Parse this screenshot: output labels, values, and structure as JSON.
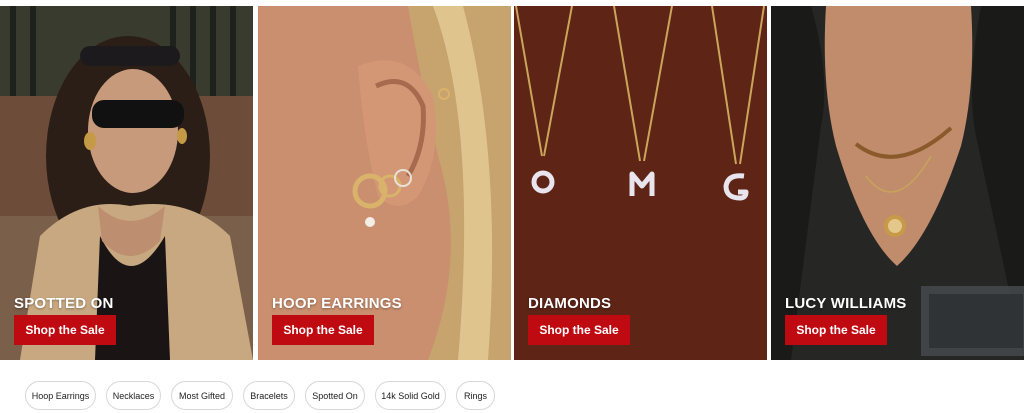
{
  "tiles": [
    {
      "title": "SPOTTED ON",
      "cta": "Shop the Sale"
    },
    {
      "title": "HOOP EARRINGS",
      "cta": "Shop the Sale"
    },
    {
      "title": "DIAMONDS",
      "cta": "Shop the Sale"
    },
    {
      "title": "LUCY WILLIAMS",
      "cta": "Shop the Sale"
    }
  ],
  "chips": [
    "Hoop Earrings",
    "Necklaces",
    "Most Gifted",
    "Bracelets",
    "Spotted On",
    "14k Solid Gold",
    "Rings"
  ],
  "colors": {
    "cta_background": "#c00a12",
    "cta_text": "#ffffff",
    "diamonds_background": "#6a2a1a"
  }
}
